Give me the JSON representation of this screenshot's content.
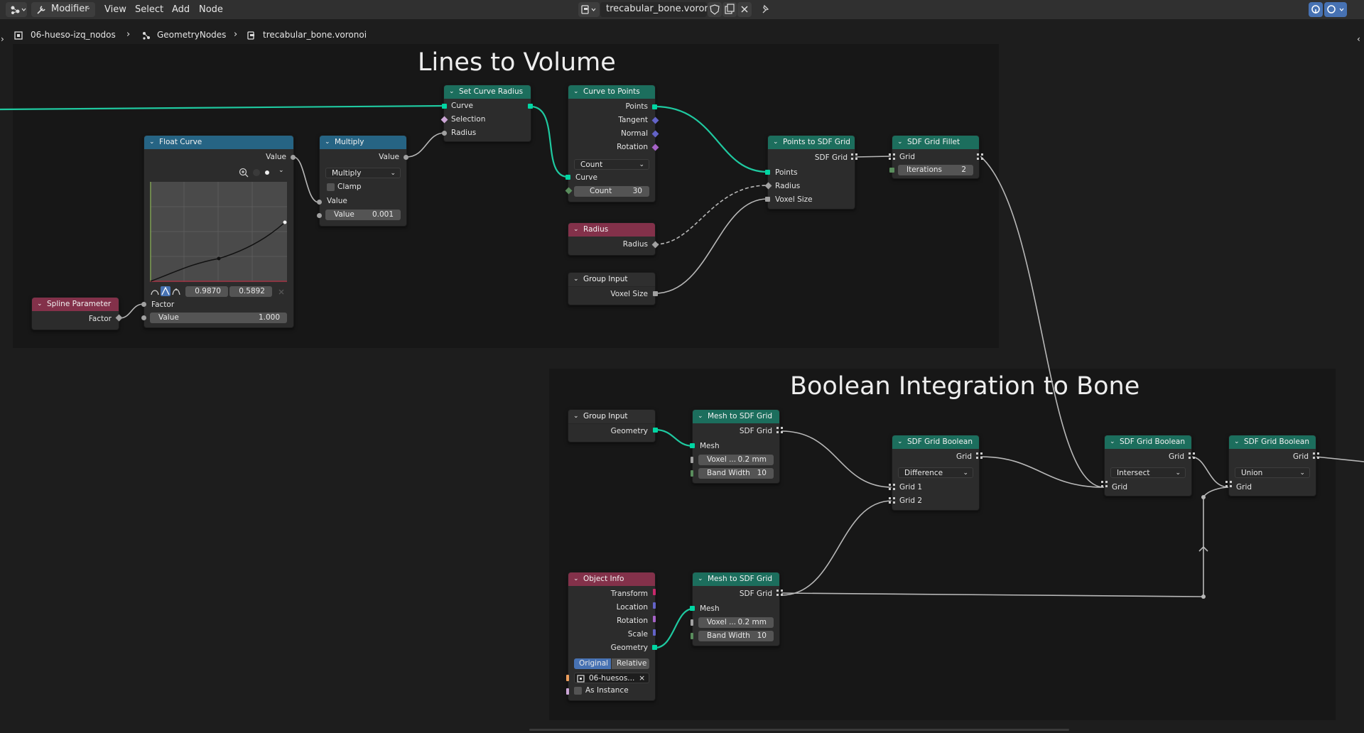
{
  "header": {
    "editor_type_icon": "node-editor-icon",
    "mode": "Modifier",
    "mode_icon": "wrench-icon",
    "menus": [
      "View",
      "Select",
      "Add",
      "Node"
    ],
    "node_tree_name": "trecabular_bone.voronoi",
    "node_tree_icon": "node-tree-icon",
    "pin_icon": "pin-icon"
  },
  "breadcrumb": {
    "items": [
      "06-hueso-izq_nodos",
      "GeometryNodes",
      "trecabular_bone.voronoi"
    ]
  },
  "frames": {
    "lines_to_volume": "Lines to Volume",
    "boolean_integration": "Boolean Integration to Bone"
  },
  "nodes": {
    "set_curve_radius": {
      "title": "Set Curve Radius",
      "out": "Curve",
      "in": [
        "Curve",
        "Selection",
        "Radius"
      ]
    },
    "curve_to_points": {
      "title": "Curve to Points",
      "outputs": [
        "Points",
        "Tangent",
        "Normal",
        "Rotation"
      ],
      "mode": "Count",
      "in": "Curve",
      "count_label": "Count",
      "count_value": "30"
    },
    "float_curve": {
      "title": "Float Curve",
      "out": "Value",
      "x": "0.9870",
      "y": "0.5892",
      "factor": "Factor",
      "value_label": "Value",
      "value_value": "1.000"
    },
    "multiply": {
      "title": "Multiply",
      "out": "Value",
      "operation": "Multiply",
      "clamp": "Clamp",
      "in": "Value",
      "value_label": "Value",
      "value_value": "0.001"
    },
    "spline_parameter": {
      "title": "Spline Parameter",
      "out": "Factor"
    },
    "radius": {
      "title": "Radius",
      "out": "Radius"
    },
    "group_input_1": {
      "title": "Group Input",
      "out": "Voxel Size"
    },
    "points_to_sdf": {
      "title": "Points to SDF Grid",
      "out": "SDF Grid",
      "in": [
        "Points",
        "Radius",
        "Voxel Size"
      ]
    },
    "sdf_fillet": {
      "title": "SDF Grid Fillet",
      "out": "Grid",
      "iter_label": "Iterations",
      "iter_value": "2"
    },
    "group_input_2": {
      "title": "Group Input",
      "out": "Geometry"
    },
    "mesh_to_sdf_1": {
      "title": "Mesh to SDF Grid",
      "out": "SDF Grid",
      "in": "Mesh",
      "voxel_label": "Voxel ...",
      "voxel_value": "0.2 mm",
      "band_label": "Band Width",
      "band_value": "10"
    },
    "mesh_to_sdf_2": {
      "title": "Mesh to SDF Grid",
      "out": "SDF Grid",
      "in": "Mesh",
      "voxel_label": "Voxel ...",
      "voxel_value": "0.2 mm",
      "band_label": "Band Width",
      "band_value": "10"
    },
    "object_info": {
      "title": "Object Info",
      "outputs": [
        "Transform",
        "Location",
        "Rotation",
        "Scale",
        "Geometry"
      ],
      "original": "Original",
      "relative": "Relative",
      "object": "06-huesos...",
      "as_instance": "As Instance"
    },
    "sdf_boolean_1": {
      "title": "SDF Grid Boolean",
      "out": "Grid",
      "operation": "Difference",
      "in": [
        "Grid 1",
        "Grid 2"
      ]
    },
    "sdf_boolean_2": {
      "title": "SDF Grid Boolean",
      "out": "Grid",
      "operation": "Intersect",
      "in": "Grid"
    },
    "sdf_boolean_3": {
      "title": "SDF Grid Boolean",
      "out": "Grid",
      "operation": "Union",
      "in": "Grid"
    }
  },
  "colors": {
    "geometry_socket": "#00d6a3",
    "float_socket": "#a1a1a1",
    "vector_socket": "#6363c7",
    "rotation_socket": "#a663c7",
    "matrix_socket": "#c7296b",
    "link_geometry": "#1fc9a0",
    "link_default": "#b8b8b8"
  }
}
